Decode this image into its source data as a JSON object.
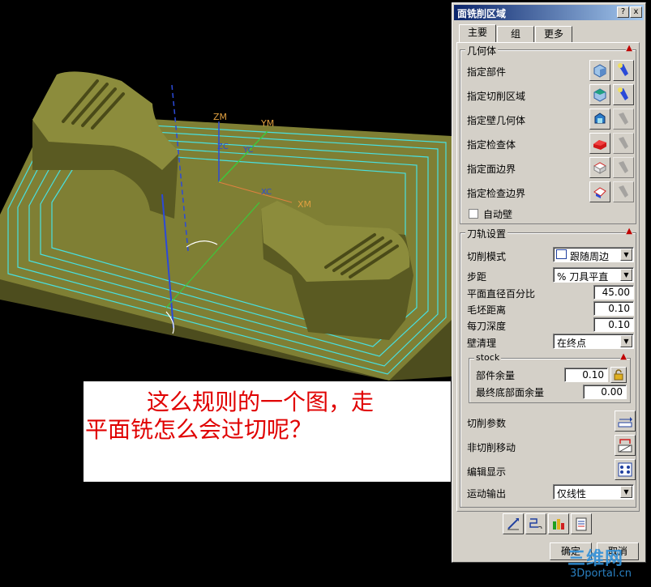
{
  "viewport": {
    "axis_labels": {
      "zm": "ZM",
      "ym": "YM",
      "zc": "ZC",
      "yc": "YC",
      "xc": "XC",
      "xm": "XM"
    },
    "annotation": {
      "line1": "这么规则的一个图，走",
      "line2": "平面铣怎么会过切呢？"
    }
  },
  "dialog": {
    "title": "面铣削区域",
    "title_buttons": [
      "?",
      "x"
    ],
    "tabs": [
      "主要",
      "组",
      "更多"
    ],
    "active_tab": "主要",
    "geometry": {
      "title": "几何体",
      "rows": [
        {
          "label": "指定部件",
          "icon": "part-icon",
          "action_icon": "flashlight-icon"
        },
        {
          "label": "指定切削区域",
          "icon": "cut-area-icon",
          "action_icon": "flashlight-icon"
        },
        {
          "label": "指定壁几何体",
          "icon": "wall-geometry-icon",
          "action_icon": "flashlight-disabled-icon"
        },
        {
          "label": "指定检查体",
          "icon": "check-body-icon",
          "action_icon": "flashlight-disabled-icon"
        },
        {
          "label": "指定面边界",
          "icon": "face-boundary-icon",
          "action_icon": "flashlight-disabled-icon"
        },
        {
          "label": "指定检查边界",
          "icon": "check-boundary-icon",
          "action_icon": "flashlight-disabled-icon"
        }
      ],
      "auto_wall_label": "自动壁",
      "auto_wall_checked": false
    },
    "path_settings": {
      "title": "刀轨设置",
      "cut_pattern_label": "切削模式",
      "cut_pattern_value": "跟随周边",
      "stepover_label": "步距",
      "stepover_value": "% 刀具平直",
      "percent_label": "平面直径百分比",
      "percent_value": "45.00",
      "blank_distance_label": "毛坯距离",
      "blank_distance_value": "0.10",
      "depth_per_cut_label": "每刀深度",
      "depth_per_cut_value": "0.10",
      "wall_cleanup_label": "壁清理",
      "wall_cleanup_value": "在终点",
      "stock": {
        "title": "stock",
        "part_stock_label": "部件余量",
        "part_stock_value": "0.10",
        "floor_stock_label": "最终底部面余量",
        "floor_stock_value": "0.00"
      },
      "cutting_params_label": "切削参数",
      "non_cutting_label": "非切削移动",
      "feeds_display_label": "编辑显示",
      "motion_output_label": "运动输出",
      "motion_output_value": "仅线性"
    },
    "bottom_icons": [
      "generate-icon",
      "replay-icon",
      "verify-icon",
      "list-icon"
    ],
    "ok_label": "确定",
    "cancel_label": "取消"
  },
  "watermark": {
    "logo": "三维网",
    "url": "3Dportal.cn"
  },
  "colors": {
    "model_fill": "#6b6b2a",
    "model_top": "#8a8a3a",
    "toolpath": "#48e0e0",
    "axis_blue": "#2c4ad8",
    "axis_label": "#e0a040",
    "axis_green": "#3cc83c",
    "annotation_text": "#e00000"
  }
}
